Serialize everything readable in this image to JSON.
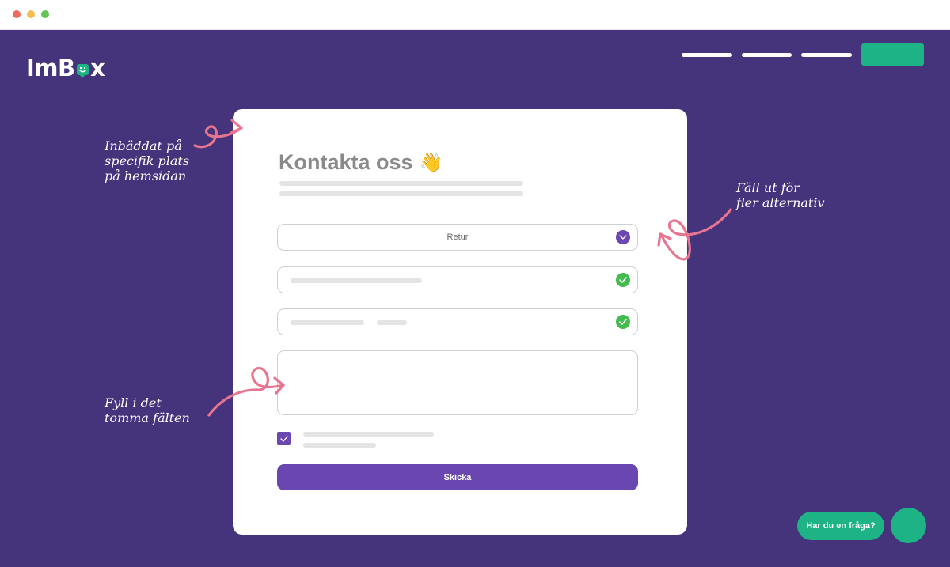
{
  "logo": {
    "prefix": "ImB",
    "suffix": "x"
  },
  "contact_form": {
    "title": "Kontakta oss",
    "title_emoji": "👋",
    "category_select": {
      "value": "Retur",
      "icon": "chevron-down-icon"
    },
    "name_field_status_icon": "check-circle-icon",
    "email_field_status_icon": "check-circle-icon",
    "consent_checked": true,
    "submit_label": "Skicka"
  },
  "annotations": {
    "embedded": "Inbäddat på\nspecifik plats\npå hemsidan",
    "expand": "Fäll ut för\nfler alternativ",
    "fill": "Fyll i det\ntomma fälten"
  },
  "chat_widget": {
    "label": "Har du en fråga?"
  },
  "colors": {
    "background": "#45347b",
    "brand_green": "#1db384",
    "button_purple": "#6a47b0",
    "check_green": "#44bb4f",
    "annotation_pink": "#e8758f"
  }
}
